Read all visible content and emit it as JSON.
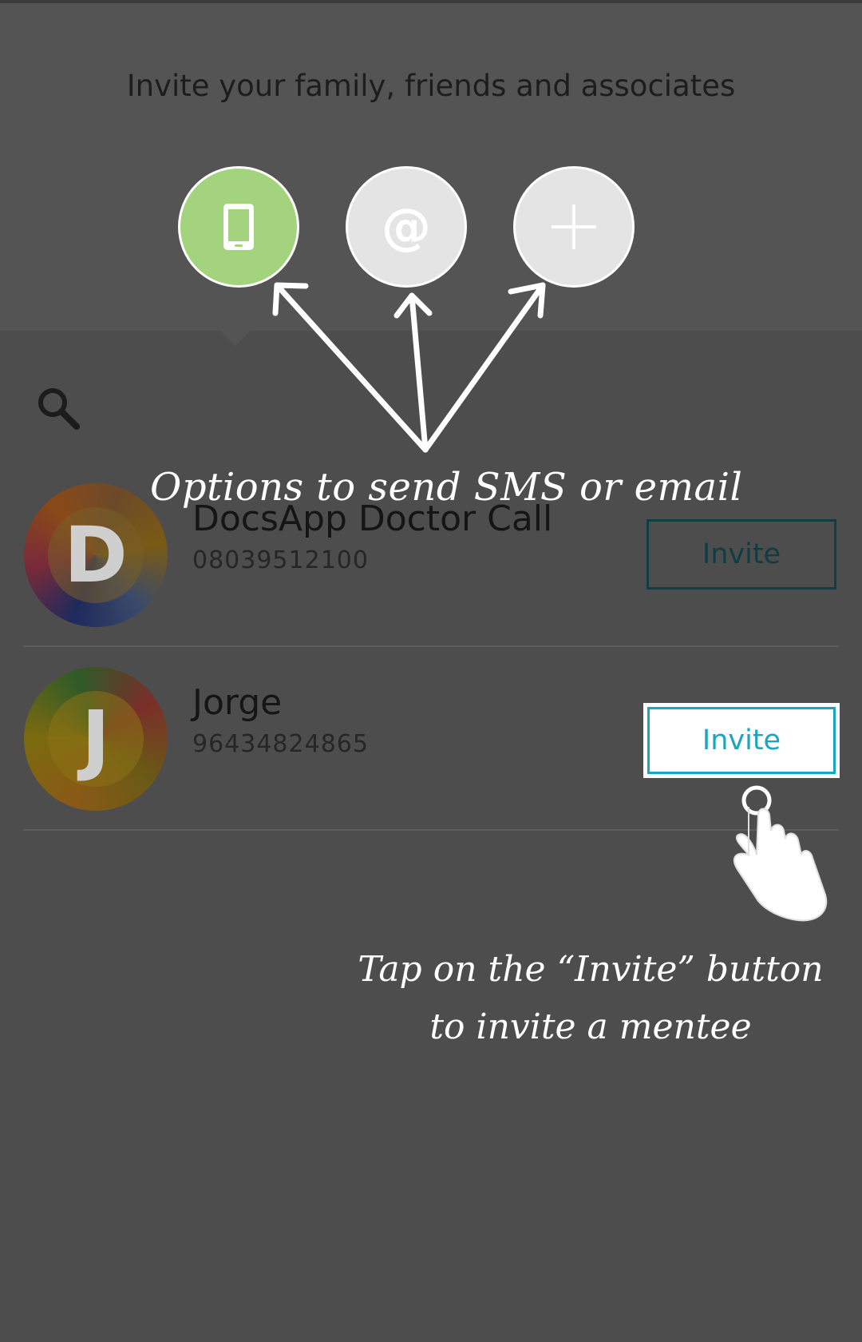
{
  "header": {
    "title": "Invite your family, friends and associates",
    "options": [
      {
        "icon": "phone-icon",
        "color": "#a3d47d"
      },
      {
        "icon": "at-icon",
        "glyph": "@",
        "color": "#e4e4e4"
      },
      {
        "icon": "plus-icon",
        "color": "#e4e4e4"
      }
    ]
  },
  "search": {
    "icon": "search-icon"
  },
  "contacts": [
    {
      "initial": "D",
      "name": "DocsApp Doctor Call",
      "phone": "08039512100",
      "invite_label": "Invite"
    },
    {
      "initial": "J",
      "name": "Jorge",
      "phone": "96434824865",
      "invite_label": "Invite"
    }
  ],
  "tutorial": {
    "caption_options": "Options to send SMS or email",
    "caption_invite_line1": "Tap on the “Invite” button",
    "caption_invite_line2": "to invite a mentee"
  },
  "colors": {
    "accent": "#19a7bf",
    "sms_green": "#a3d47d"
  }
}
